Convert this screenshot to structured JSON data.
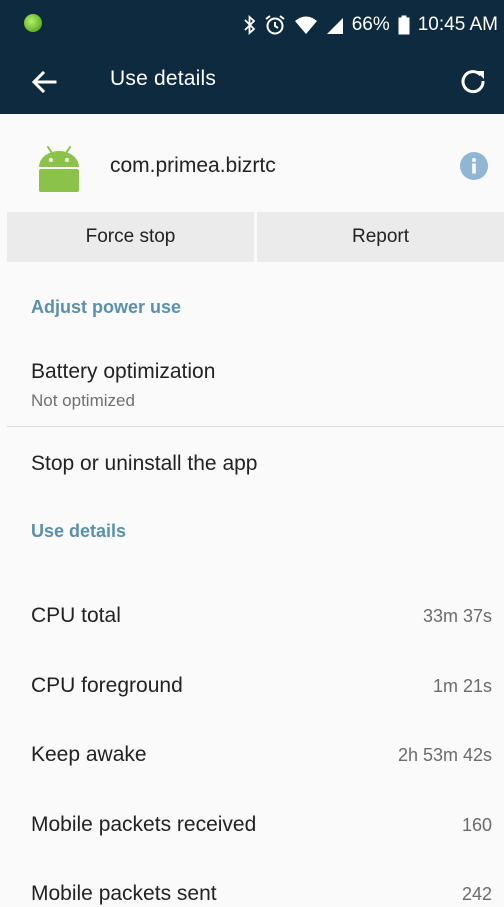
{
  "status_bar": {
    "battery_percent": "66%",
    "time": "10:45 AM",
    "icons": [
      "bluetooth-icon",
      "alarm-icon",
      "wifi-icon",
      "signal-icon",
      "battery-icon"
    ]
  },
  "app_bar": {
    "title": "Use details",
    "back_icon": "arrow-back-icon",
    "refresh_icon": "refresh-icon"
  },
  "app_header": {
    "package_name": "com.primea.bizrtc",
    "logo_icon": "android-icon",
    "info_icon": "info-icon"
  },
  "actions": {
    "force_stop": "Force stop",
    "report": "Report"
  },
  "power_section": {
    "header": "Adjust power use",
    "battery_optimization": {
      "title": "Battery optimization",
      "value": "Not optimized"
    },
    "stop_uninstall": "Stop or uninstall the app"
  },
  "use_details_section": {
    "header": "Use details",
    "stats": [
      {
        "label": "CPU total",
        "value": "33m 37s"
      },
      {
        "label": "CPU foreground",
        "value": "1m 21s"
      },
      {
        "label": "Keep awake",
        "value": "2h 53m 42s"
      },
      {
        "label": "Mobile packets received",
        "value": "160"
      },
      {
        "label": "Mobile packets sent",
        "value": "242"
      }
    ]
  },
  "colors": {
    "app_bar": "#0d2a3e",
    "section_header": "#5b8fae",
    "android_green": "#8bc34a",
    "info_blue": "#8fb6d3",
    "button_bg": "#ebebeb"
  }
}
